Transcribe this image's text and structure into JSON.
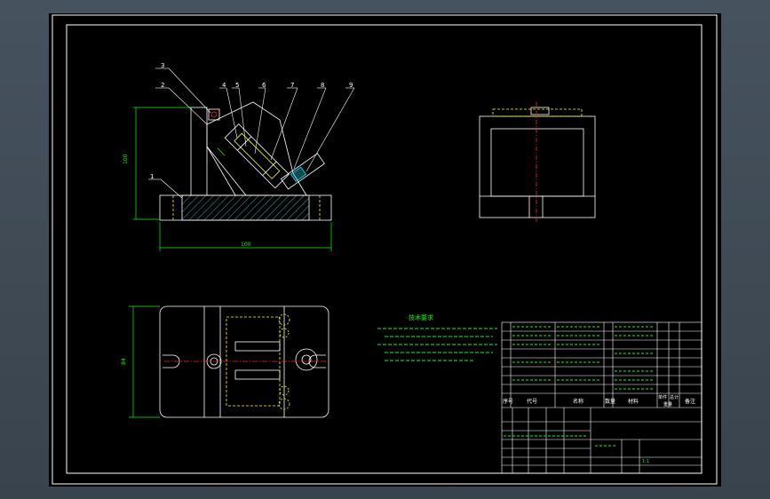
{
  "colors": {
    "background": "#000000",
    "frame": "#ffffff",
    "outline": "#ffffff",
    "dimension": "#00ff00",
    "center_line": "#ff2020",
    "hidden_line": "#ffff00",
    "hatch": "#2fa8a8",
    "part_cyan": "#22d8f0",
    "notes_text": "#00ff00",
    "leader": "#ffffff"
  },
  "balloons": [
    "1",
    "2",
    "3",
    "4",
    "5",
    "6",
    "7",
    "8",
    "9"
  ],
  "dimensions": {
    "front_height": "100",
    "front_width": "100",
    "plan_height": "84"
  },
  "notes": {
    "title": "技术要求"
  },
  "bom_header": {
    "seq": "序号",
    "code": "代号",
    "name": "名称",
    "qty": "数量",
    "material": "材料",
    "unit_weight": "单件",
    "total_weight": "总计",
    "weight": "重量",
    "remark": "备注"
  },
  "title_block": {
    "scale": "1:1"
  }
}
